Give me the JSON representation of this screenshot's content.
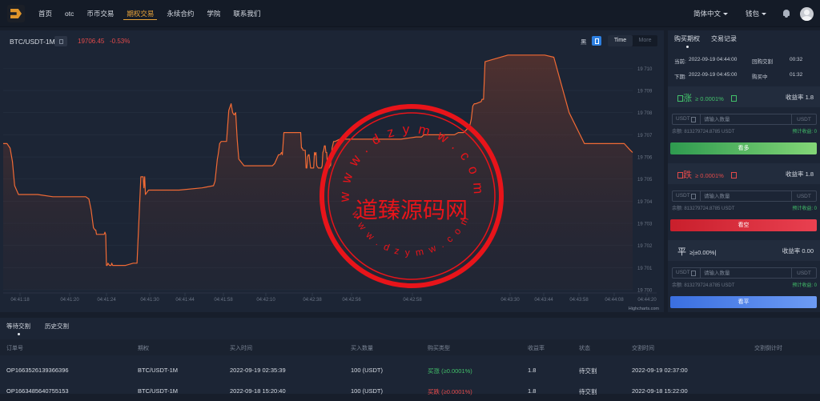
{
  "nav": {
    "items": [
      "首页",
      "otc",
      "币币交易",
      "期权交易",
      "永续合约",
      "学院",
      "联系我们"
    ],
    "active_index": 3,
    "language": "简体中文",
    "wallet": "钱包"
  },
  "chart_header": {
    "pair": "BTC/USDT-1M",
    "price": "19706.45",
    "change": "-0.53%",
    "theme_label": "黑",
    "modes": [
      "Time",
      "More"
    ],
    "active_mode": "Time"
  },
  "chart_data": {
    "type": "line",
    "ylim": [
      19700,
      19710.7
    ],
    "y_ticks": [
      19700,
      19701,
      19702,
      19703,
      19704,
      19705,
      19706,
      19707,
      19708,
      19709,
      19710
    ],
    "y_tick_labels": [
      "19 700",
      "19 701",
      "19 702",
      "19 703",
      "19 704",
      "19 705",
      "19 706",
      "19 707",
      "19 708",
      "19 709",
      "19 710"
    ],
    "x_labels": [
      "04:41:18",
      "04:41:20",
      "04:41:24",
      "04:41:30",
      "04:41:44",
      "04:41:58",
      "04:42:10",
      "04:42:38",
      "04:42:56",
      "04:42:58",
      "04:43:30",
      "04:43:44",
      "04:43:58",
      "04:44:08",
      "04:44:20"
    ],
    "credit": "Highcharts.com",
    "color": "#f06a35",
    "x": [
      0,
      5,
      9,
      12,
      15,
      20,
      30,
      45,
      65,
      75,
      78,
      90,
      100,
      108,
      112,
      115,
      118,
      120,
      121,
      122,
      123,
      124,
      128,
      132,
      133,
      134,
      135,
      136,
      137,
      139,
      141,
      142,
      143,
      145,
      150,
      160,
      170,
      175,
      180,
      182,
      183,
      184,
      185,
      186,
      188,
      190,
      200,
      230,
      260,
      275,
      277,
      280,
      281,
      283,
      285,
      286,
      288,
      290,
      292,
      295,
      298,
      300,
      302,
      304,
      306,
      308,
      315,
      330,
      345,
      350,
      352,
      355,
      360,
      362,
      364,
      365,
      367,
      369,
      372,
      375,
      380,
      385,
      387,
      389,
      390,
      391,
      392,
      394,
      395,
      396,
      397,
      398,
      399,
      400,
      402,
      403,
      404,
      405,
      406,
      407,
      408,
      409,
      410,
      412,
      414,
      415,
      416,
      417,
      418,
      419,
      420,
      421,
      422,
      423,
      424,
      425,
      426,
      427,
      428,
      429,
      430,
      432,
      434,
      440,
      460,
      480,
      500,
      520,
      540,
      545,
      547,
      550,
      560,
      575,
      590,
      595,
      598,
      602,
      605,
      610,
      612,
      614,
      616,
      617,
      618,
      625,
      626,
      628,
      630,
      640,
      660,
      680,
      690,
      700,
      703,
      705,
      708,
      720,
      740,
      760,
      770,
      773,
      776,
      780,
      800,
      812,
      820,
      823
    ],
    "y": [
      19706.6,
      19706.6,
      19706.4,
      19705.8,
      19704.7,
      19704.3,
      19704.3,
      19704.3,
      19704.2,
      19704.2,
      19704.2,
      19704.2,
      19704.2,
      19704.2,
      19704.1,
      19703.6,
      19702.8,
      19702.7,
      19702.7,
      19702.5,
      19702.5,
      19702.5,
      19702.5,
      19702.5,
      19702.6,
      19702.5,
      19701.1,
      19701.1,
      19701.2,
      19701.1,
      19701.1,
      19701.2,
      19701.1,
      19701.1,
      19701.1,
      19701.1,
      19701.2,
      19701.2,
      19705.1,
      19705.1,
      19705.1,
      19704.6,
      19705.1,
      19704.3,
      19704.4,
      19704.5,
      19704.5,
      19704.5,
      19704.6,
      19704.7,
      19704.9,
      19705.9,
      19706.1,
      19706.6,
      19706.7,
      19706.7,
      19706.7,
      19706.7,
      19706.7,
      19708.1,
      19708.4,
      19708.0,
      19707.9,
      19708.0,
      19706.8,
      19705.9,
      19705.6,
      19705.6,
      19705.6,
      19705.6,
      19705.6,
      19705.7,
      19706.1,
      19706.1,
      19706.2,
      19706.1,
      19707.1,
      19707.1,
      19707.1,
      19707.1,
      19707.1,
      19707.1,
      19707.1,
      19707.1,
      19706.4,
      19706.4,
      19706.3,
      19706.3,
      19706.3,
      19705.5,
      19705.5,
      19706.0,
      19706.1,
      19706.1,
      19705.5,
      19705.5,
      19705.5,
      19705.5,
      19705.5,
      19706.2,
      19706.1,
      19706.2,
      19705.6,
      19705.5,
      19705.5,
      19705.5,
      19705.5,
      19705.6,
      19706.2,
      19706.3,
      19706.5,
      19706.5,
      19706.2,
      19706.2,
      19705.6,
      19705.5,
      19705.5,
      19705.6,
      19705.6,
      19706.0,
      19706.4,
      19706.7,
      19706.7,
      19706.8,
      19706.8,
      19706.8,
      19706.8,
      19706.8,
      19706.9,
      19706.9,
      19706.9,
      19707.0,
      19707.0,
      19707.0,
      19707.0,
      19707.1,
      19707.1,
      19707.1,
      19707.2,
      19707.4,
      19707.7,
      19708.3,
      19708.4,
      19708.4,
      19708.4,
      19708.5,
      19708.6,
      19708.6,
      19710.3,
      19710.4,
      19710.6,
      19710.6,
      19710.6,
      19710.6,
      19710.6,
      19710.6,
      19710.6,
      19710.5,
      19708.0,
      19706.6,
      19706.6,
      19706.6,
      19706.6,
      19706.6,
      19706.6,
      19706.6,
      19706.3,
      19706.2,
      19706.2,
      19706.2,
      19706.2,
      19706.2,
      19706.2
    ]
  },
  "watermark": {
    "text": "道臻源码网",
    "url_top": "www.dzymw.com",
    "url_bottom": "www.dzymw.com"
  },
  "order_panel": {
    "tabs": [
      "购买期权",
      "交易记录"
    ],
    "current_label": "当前:",
    "current_time": "2022-09-19 04:44:00",
    "current_status": "回购交割",
    "current_countdown": "00:32",
    "next_label": "下期:",
    "next_time": "2022-09-19 04:45:00",
    "next_status": "购买中",
    "next_countdown": "01:32",
    "sections": [
      {
        "sign": "涨",
        "threshold": "≥ 0.0001%",
        "rate_label": "收益率",
        "rate": "1.8",
        "color": "#42c06a",
        "button": "看多",
        "button_color": "linear-gradient(90deg,#2e9a4f,#83d677)"
      },
      {
        "sign": "跌",
        "threshold": "≥ 0.0001%",
        "rate_label": "收益率",
        "rate": "1.8",
        "color": "#e24a4a",
        "button": "看空",
        "button_color": "linear-gradient(90deg,#c91f2c,#e94050)"
      },
      {
        "sign": "平",
        "threshold": "≥|±0.00%|",
        "rate_label": "收益率",
        "rate": "0.00",
        "color": "#d8dde5",
        "button": "看平",
        "button_color": "linear-gradient(90deg,#3a6fe0,#6d9bf4)"
      }
    ],
    "unit": "USDT",
    "amount_placeholder": "请输入数量",
    "balance_label": "余额:",
    "balance": "813279724.8785 USDT",
    "estimate_label": "预计收益:",
    "estimate": "0"
  },
  "bottom": {
    "tabs": [
      "等待交割",
      "历史交割"
    ],
    "columns": [
      "订单号",
      "期权",
      "买入时间",
      "买入数量",
      "购买类型",
      "收益率",
      "状态",
      "交割时间",
      "交割倒计时"
    ],
    "rows": [
      {
        "id": "OP1663526139366396",
        "option": "BTC/USDT-1M",
        "buy_time": "2022-09-19 02:35:39",
        "amount": "100 (USDT)",
        "type": "买涨 (≥0.0001%)",
        "type_color": "up",
        "rate": "1.8",
        "status": "待交割",
        "settle_time": "2022-09-19 02:37:00"
      },
      {
        "id": "OP1663485640755153",
        "option": "BTC/USDT-1M",
        "buy_time": "2022-09-18 15:20:40",
        "amount": "100 (USDT)",
        "type": "买跌 (≥0.0001%)",
        "type_color": "down",
        "rate": "1.8",
        "status": "待交割",
        "settle_time": "2022-09-18 15:22:00"
      }
    ]
  }
}
